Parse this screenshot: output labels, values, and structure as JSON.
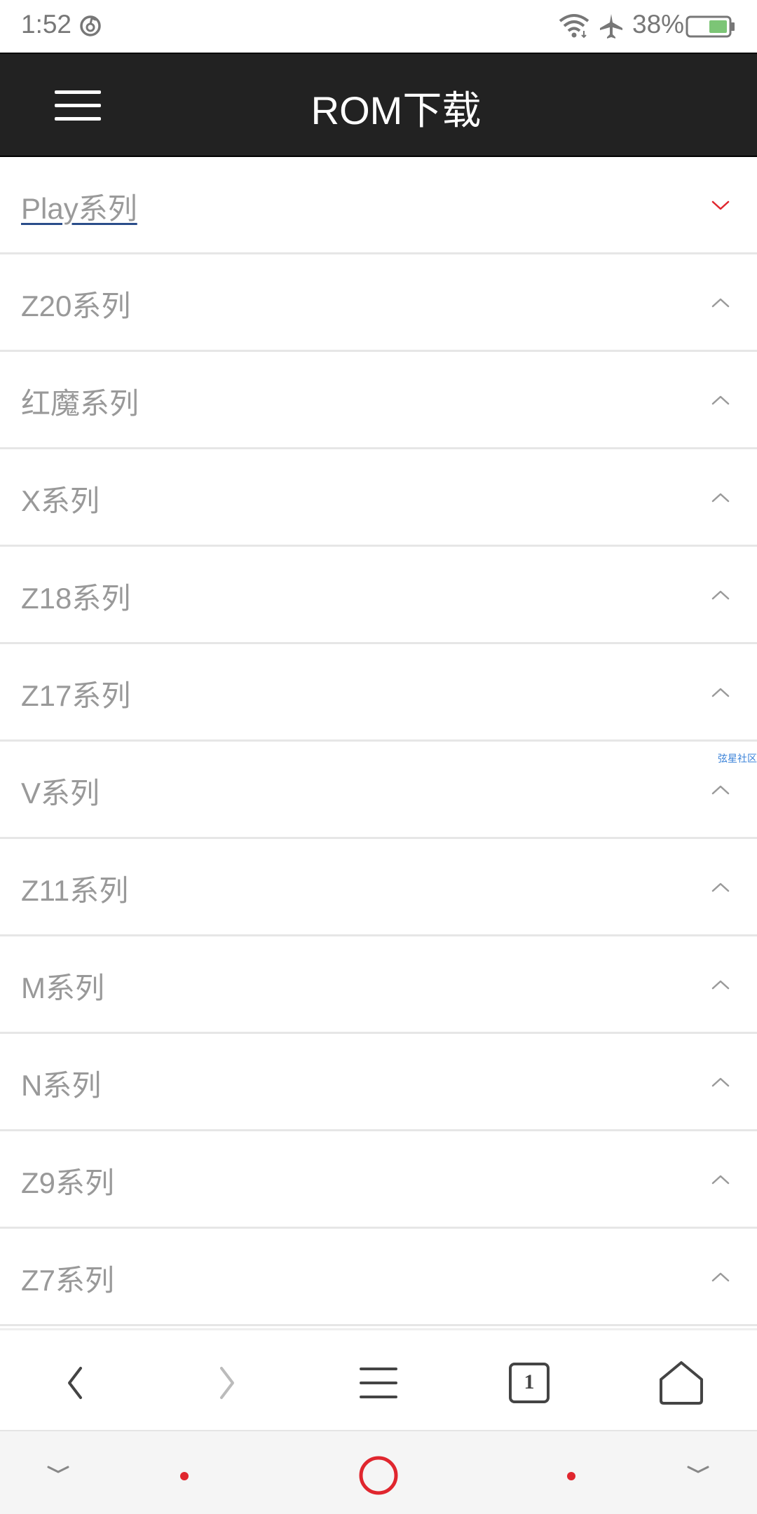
{
  "status_bar": {
    "time": "1:52",
    "battery_percent": "38%",
    "battery_level": 0.38,
    "icons": [
      "netease-cloud-music-icon",
      "wifi-icon",
      "airplane-mode-icon",
      "battery-icon"
    ]
  },
  "header": {
    "title": "ROM下载",
    "menu_icon": "hamburger-menu-icon"
  },
  "series": [
    {
      "label": "Play系列",
      "state": "active"
    },
    {
      "label": "Z20系列",
      "state": "collapsed"
    },
    {
      "label": "红魔系列",
      "state": "collapsed"
    },
    {
      "label": "X系列",
      "state": "collapsed"
    },
    {
      "label": "Z18系列",
      "state": "collapsed"
    },
    {
      "label": "Z17系列",
      "state": "collapsed"
    },
    {
      "label": "V系列",
      "state": "collapsed"
    },
    {
      "label": "Z11系列",
      "state": "collapsed"
    },
    {
      "label": "M系列",
      "state": "collapsed"
    },
    {
      "label": "N系列",
      "state": "collapsed"
    },
    {
      "label": "Z9系列",
      "state": "collapsed"
    },
    {
      "label": "Z7系列",
      "state": "collapsed"
    }
  ],
  "watermark": "弦星社区",
  "browser_toolbar": {
    "tab_count": "1",
    "icons": [
      "back-icon",
      "forward-icon",
      "menu-icon",
      "tabs-icon",
      "home-icon"
    ]
  },
  "system_nav": {
    "icons": [
      "collapse-left-icon",
      "dot-left-icon",
      "home-circle-icon",
      "dot-right-icon",
      "collapse-right-icon"
    ]
  },
  "colors": {
    "header_bg": "#222222",
    "accent_red": "#e0262e",
    "text_gray": "#999999",
    "divider": "#e6e6e6",
    "link_underline": "#2a4d8a"
  }
}
